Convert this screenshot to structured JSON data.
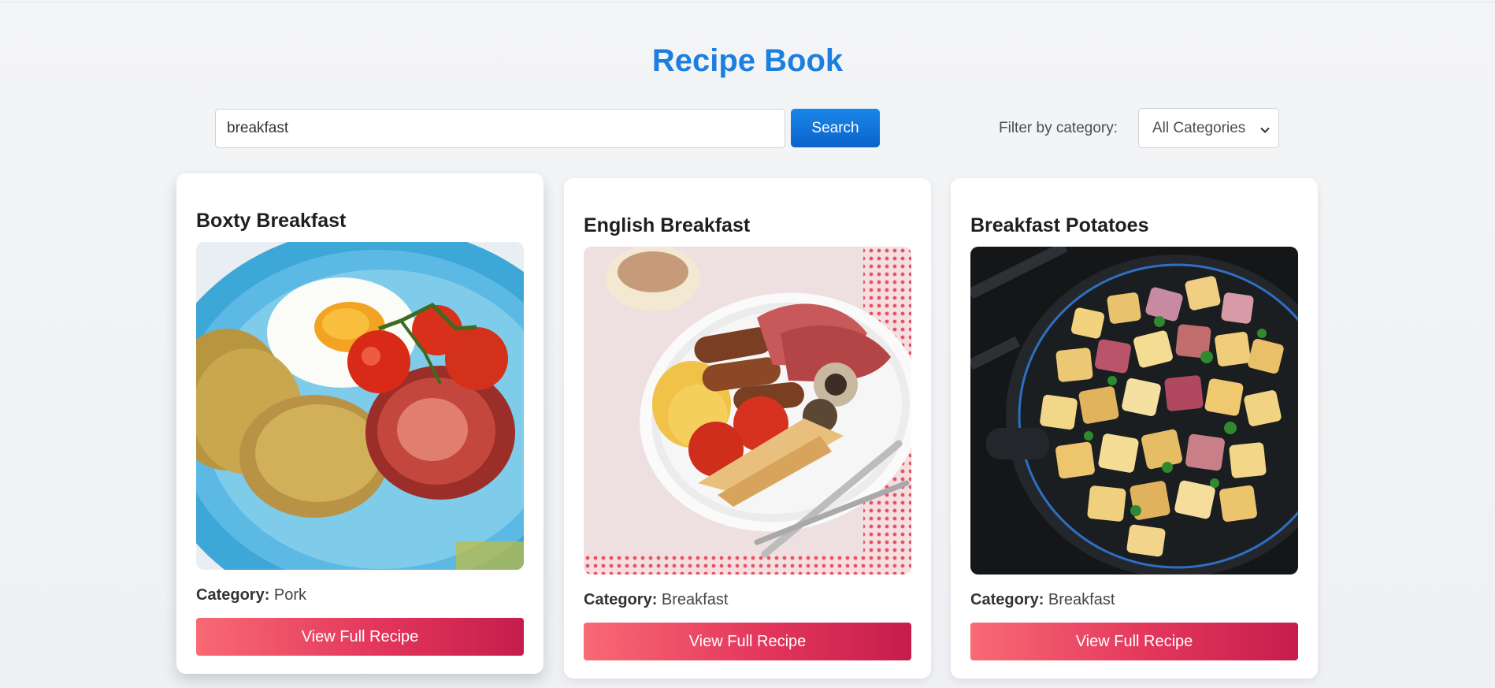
{
  "header": {
    "title": "Recipe Book"
  },
  "search": {
    "value": "breakfast",
    "button_label": "Search"
  },
  "filter": {
    "label": "Filter by category:",
    "selected": "All Categories"
  },
  "recipes": [
    {
      "title": "Boxty Breakfast",
      "category_label": "Category:",
      "category": "Pork",
      "button_label": "View Full Recipe"
    },
    {
      "title": "English Breakfast",
      "category_label": "Category:",
      "category": "Breakfast",
      "button_label": "View Full Recipe"
    },
    {
      "title": "Breakfast Potatoes",
      "category_label": "Category:",
      "category": "Breakfast",
      "button_label": "View Full Recipe"
    }
  ],
  "colors": {
    "title_blue": "#1a7fe0",
    "search_button": "#0b63c9",
    "recipe_button_start": "#f86a74",
    "recipe_button_end": "#c51d4c"
  }
}
